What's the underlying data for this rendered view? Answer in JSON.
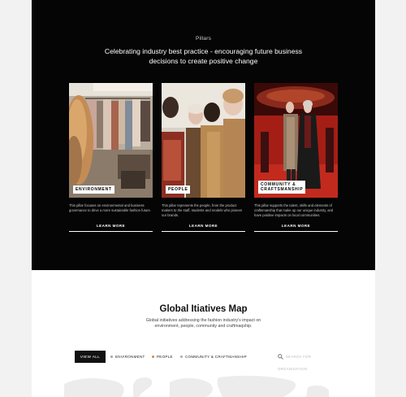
{
  "pillars": {
    "eyebrow": "Pillars",
    "headline": "Celebrating industry best practice - encouraging future business decisions to create positive change",
    "cards": [
      {
        "tag": "ENVIRONMENT",
        "description": "This pillar focuses on environmental and business governance to drive a more sustainable fashion future.",
        "link": "LEARN MORE"
      },
      {
        "tag": "PEOPLE",
        "description": "This pillar represents the people, from the product makers to the staff, students and models who pioneer our brands.",
        "link": "LEARN MORE"
      },
      {
        "tag": "COMMUNITY & CRAFTSMANSHIP",
        "tag_line1": "COMMUNITY &",
        "tag_line2": "CRAFTSMANSHIP",
        "description": "This pillar supports the talent, skills and elements of craftsmanship that make up our unique industry, and have positive impacts on local communities.",
        "link": "LEARN MORE"
      }
    ]
  },
  "map": {
    "title": "Global Itiatives Map",
    "subtitle": "Global initiatives addressing the fashion industry's impact on environment, people, community and craftmaqship.",
    "filters": {
      "all": "VIEW ALL",
      "environment": "ENVIRONMENT",
      "people": "PEOPLE",
      "community": "COMMUNITY & CRAFTMANSHIP"
    },
    "search_placeholder": "SEARCH FOR ORGANISATION"
  },
  "colors": {
    "environment_dot": "#9aa7b0",
    "people_dot": "#d98a3c",
    "community_dot": "#b8a9a0"
  }
}
